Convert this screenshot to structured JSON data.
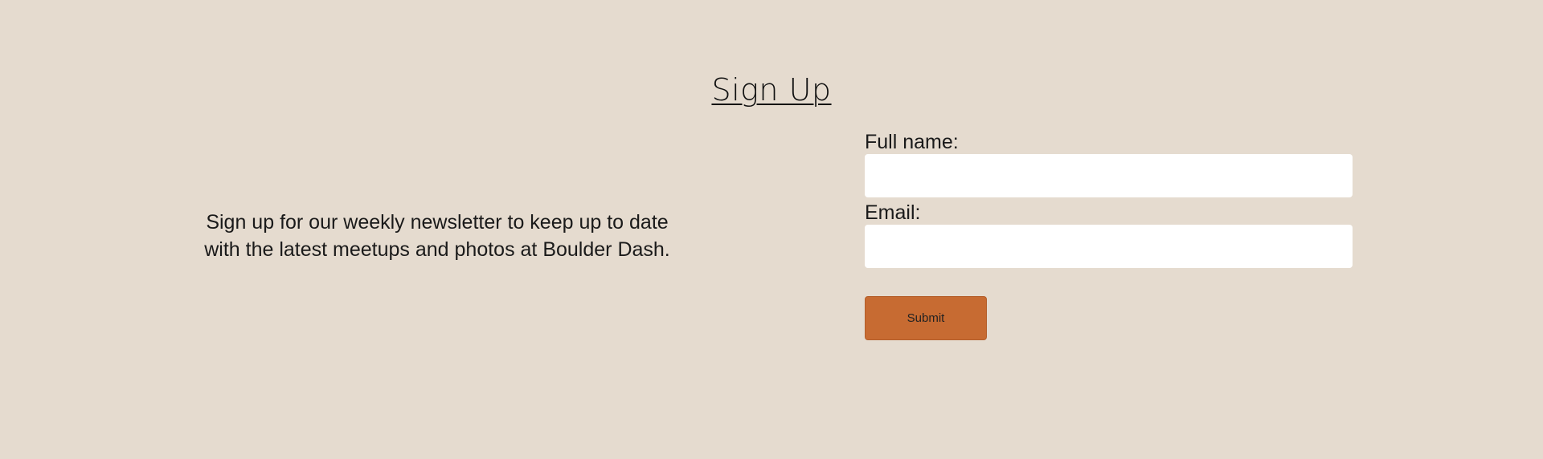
{
  "page": {
    "title": "Sign Up",
    "intro_line_1": "Sign up for our weekly newsletter to keep up to date",
    "intro_line_2": "with the latest meetups and photos at Boulder Dash."
  },
  "form": {
    "name_label": "Full name:",
    "name_value": "",
    "email_label": "Email:",
    "email_value": "",
    "submit_label": "Submit"
  },
  "colors": {
    "background": "#e5dbcf",
    "button": "#c76b32",
    "input": "#ffffff"
  }
}
